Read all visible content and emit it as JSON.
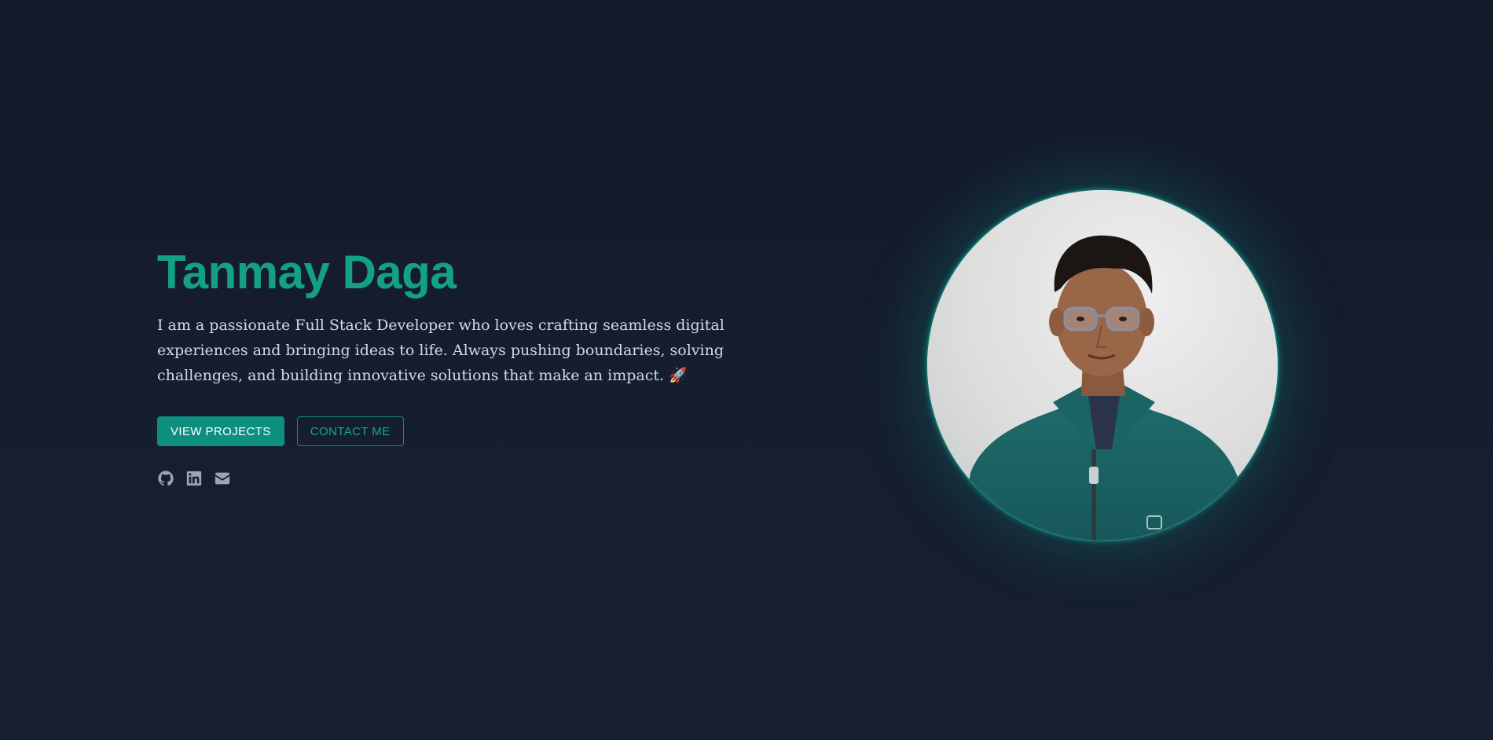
{
  "hero": {
    "name": "Tanmay Daga",
    "bio": "I am a passionate Full Stack Developer who loves crafting seamless digital experiences and bringing ideas to life. Always pushing boundaries, solving challenges, and building innovative solutions that make an impact. 🚀",
    "buttons": {
      "primary_label": "VIEW PROJECTS",
      "secondary_label": "CONTACT ME"
    },
    "socials": [
      {
        "icon": "github-icon"
      },
      {
        "icon": "linkedin-icon"
      },
      {
        "icon": "mail-icon"
      }
    ],
    "photo": {
      "icon": "profile-photo"
    }
  },
  "colors": {
    "background": "#141b2b",
    "accent": "#13a083",
    "primary_button": "#0d8f80",
    "body_text": "#d3d9e3",
    "icon": "#9aa5b8"
  }
}
